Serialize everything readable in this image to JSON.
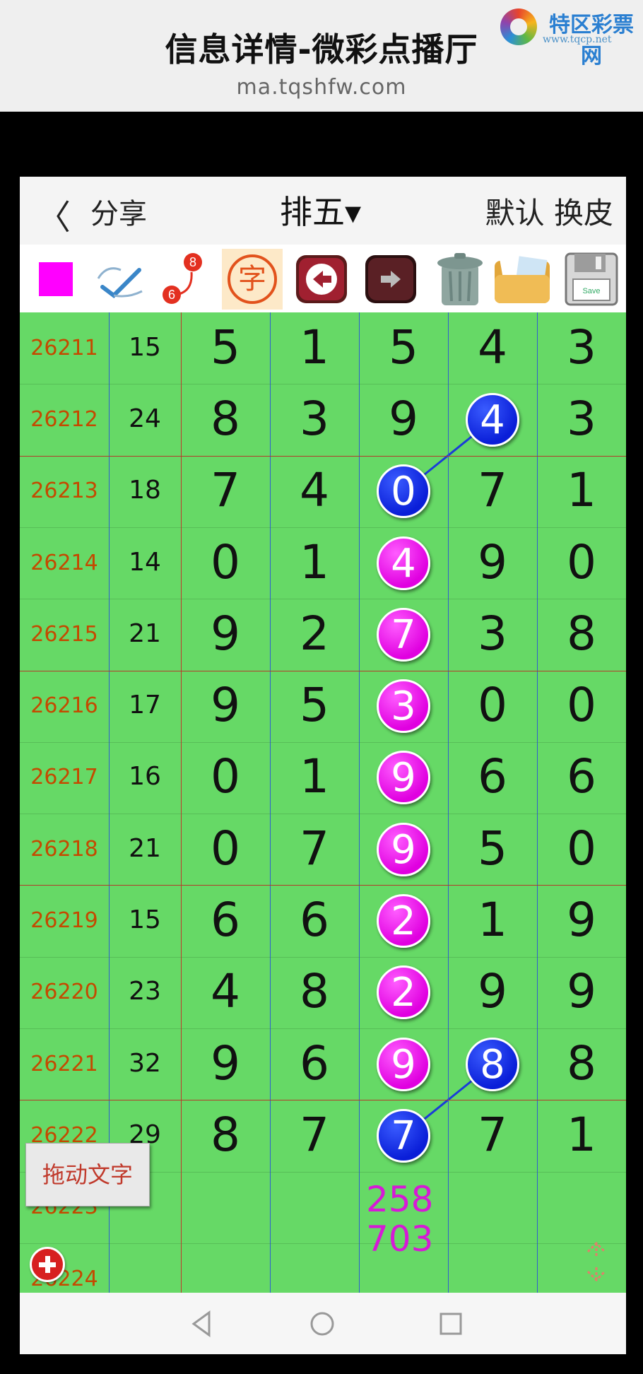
{
  "page": {
    "title": "信息详情-微彩点播厅",
    "url": "ma.tqshfw.com"
  },
  "logo": {
    "name": "特区彩票网",
    "url": "www.tqcp.net"
  },
  "app_header": {
    "back": "〈",
    "share": "分享",
    "game": "排五▾",
    "default": "默认",
    "skin": "换皮"
  },
  "toolbar": [
    {
      "name": "color-square-icon",
      "color": "#ff00ff"
    },
    {
      "name": "pen-check-icon"
    },
    {
      "name": "connect-numbers-icon",
      "top": "8",
      "bottom": "6"
    },
    {
      "name": "text-tool-icon",
      "label": "字"
    },
    {
      "name": "undo-arrow-icon"
    },
    {
      "name": "redo-arrow-icon"
    },
    {
      "name": "trash-can-icon"
    },
    {
      "name": "photo-folder-icon"
    },
    {
      "name": "save-floppy-icon",
      "label": "Save"
    }
  ],
  "rows": [
    {
      "issue": "26211",
      "sum": "15",
      "digits": [
        "5",
        "1",
        "5",
        "4",
        "3"
      ]
    },
    {
      "issue": "26212",
      "sum": "24",
      "digits": [
        "8",
        "3",
        "9",
        "4",
        "3"
      ]
    },
    {
      "issue": "26213",
      "sum": "18",
      "digits": [
        "7",
        "4",
        "0",
        "7",
        "1"
      ]
    },
    {
      "issue": "26214",
      "sum": "14",
      "digits": [
        "0",
        "1",
        "4",
        "9",
        "0"
      ]
    },
    {
      "issue": "26215",
      "sum": "21",
      "digits": [
        "9",
        "2",
        "7",
        "3",
        "8"
      ]
    },
    {
      "issue": "26216",
      "sum": "17",
      "digits": [
        "9",
        "5",
        "3",
        "0",
        "0"
      ]
    },
    {
      "issue": "26217",
      "sum": "16",
      "digits": [
        "0",
        "1",
        "9",
        "6",
        "6"
      ]
    },
    {
      "issue": "26218",
      "sum": "21",
      "digits": [
        "0",
        "7",
        "9",
        "5",
        "0"
      ]
    },
    {
      "issue": "26219",
      "sum": "15",
      "digits": [
        "6",
        "6",
        "2",
        "1",
        "9"
      ]
    },
    {
      "issue": "26220",
      "sum": "23",
      "digits": [
        "4",
        "8",
        "2",
        "9",
        "9"
      ]
    },
    {
      "issue": "26221",
      "sum": "32",
      "digits": [
        "9",
        "6",
        "9",
        "8",
        "8"
      ]
    },
    {
      "issue": "26222",
      "sum": "29",
      "digits": [
        "8",
        "7",
        "7",
        "7",
        "1"
      ]
    },
    {
      "issue": "26223",
      "sum": "",
      "digits": [
        "",
        "",
        "",
        "",
        ""
      ]
    },
    {
      "issue": "26224",
      "sum": "",
      "digits": [
        "",
        "",
        "",
        "",
        ""
      ]
    }
  ],
  "highlights": [
    {
      "row": 1,
      "col": 3,
      "color": "blue"
    },
    {
      "row": 2,
      "col": 2,
      "color": "blue"
    },
    {
      "row": 3,
      "col": 2,
      "color": "magenta"
    },
    {
      "row": 4,
      "col": 2,
      "color": "magenta"
    },
    {
      "row": 5,
      "col": 2,
      "color": "magenta"
    },
    {
      "row": 6,
      "col": 2,
      "color": "magenta"
    },
    {
      "row": 7,
      "col": 2,
      "color": "magenta"
    },
    {
      "row": 8,
      "col": 2,
      "color": "magenta"
    },
    {
      "row": 9,
      "col": 2,
      "color": "magenta"
    },
    {
      "row": 10,
      "col": 2,
      "color": "magenta"
    },
    {
      "row": 10,
      "col": 3,
      "color": "blue"
    },
    {
      "row": 11,
      "col": 2,
      "color": "blue"
    }
  ],
  "links": [
    {
      "from": [
        1,
        3
      ],
      "to": [
        2,
        2
      ]
    },
    {
      "from": [
        10,
        3
      ],
      "to": [
        11,
        2
      ]
    }
  ],
  "prediction": [
    "258",
    "703"
  ],
  "drag_text_button": "拖动文字",
  "colors": {
    "grid_bg": "#66d966",
    "issue": "#c44a00",
    "ball_blue": "#0a1ed8",
    "ball_magenta": "#e000e0",
    "prediction": "#d61ad6"
  }
}
